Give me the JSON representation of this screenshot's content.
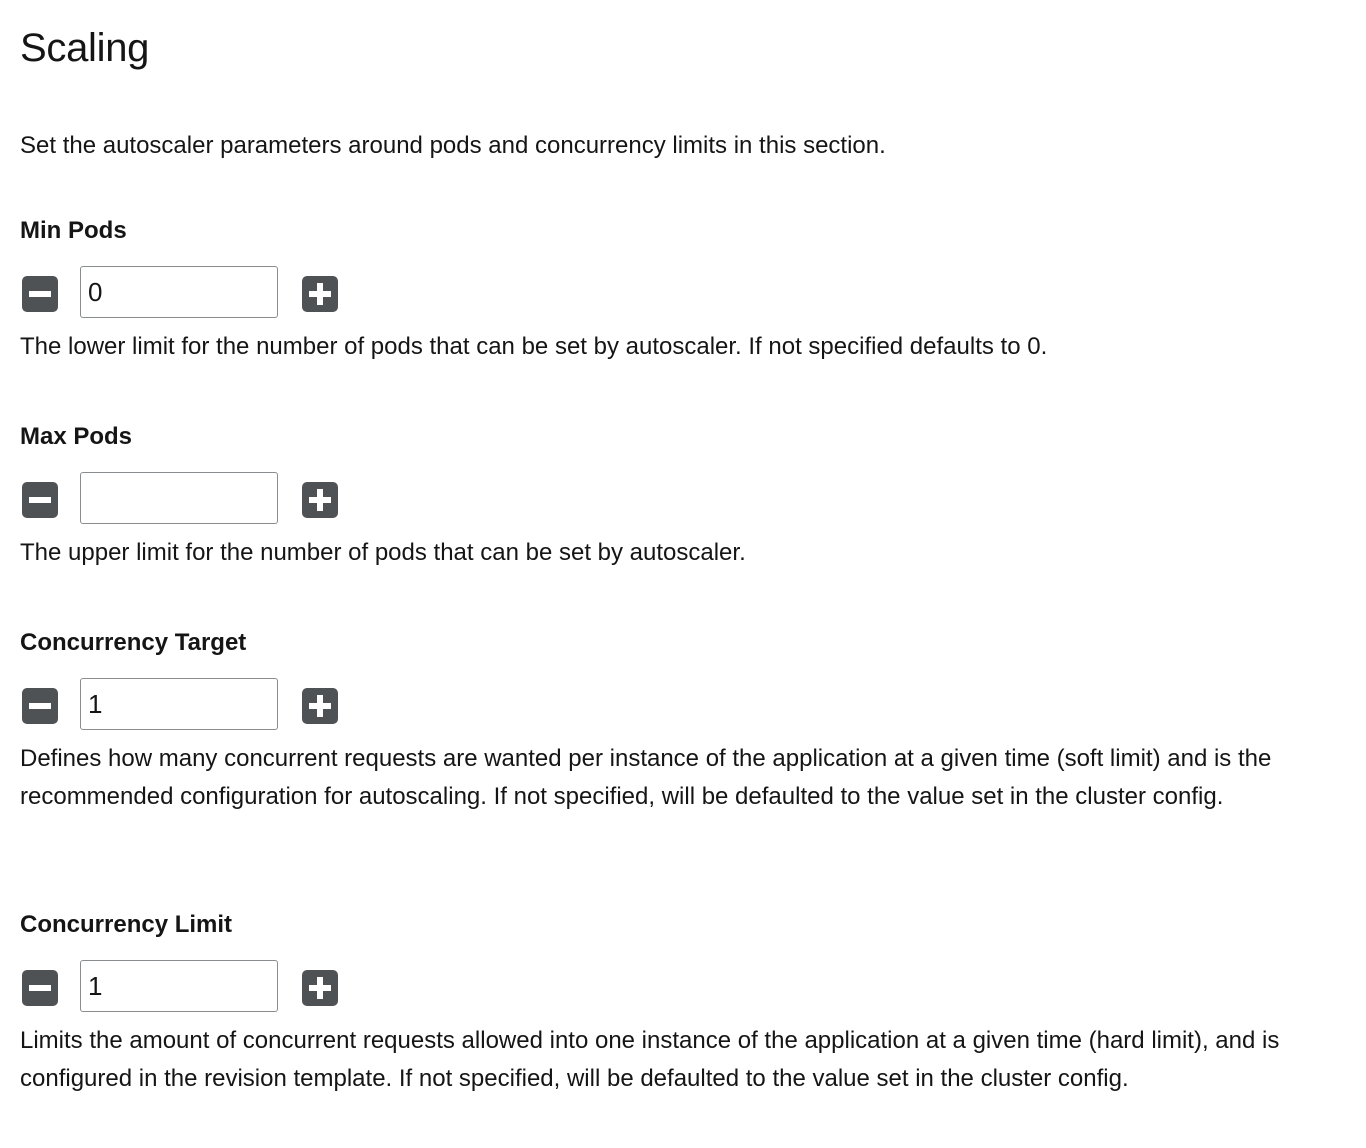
{
  "section": {
    "title": "Scaling",
    "description": "Set the autoscaler parameters around pods and concurrency limits in this section."
  },
  "fields": [
    {
      "label": "Min Pods",
      "value": "0",
      "helper": "The lower limit for the number of pods that can be set by autoscaler. If not specified defaults to 0."
    },
    {
      "label": "Max Pods",
      "value": "",
      "helper": "The upper limit for the number of pods that can be set by autoscaler."
    },
    {
      "label": "Concurrency Target",
      "value": "1",
      "helper": "Defines how many concurrent requests are wanted per instance of the application at a given time (soft limit) and is the recommended configuration for autoscaling. If not specified, will be defaulted to the value set in the cluster config."
    },
    {
      "label": "Concurrency Limit",
      "value": "1",
      "helper": "Limits the amount of concurrent requests allowed into one instance of the application at a given time (hard limit), and is configured in the revision template. If not specified, will be defaulted to the value set in the cluster config."
    }
  ],
  "icons": {
    "decrement": "minus-square-icon",
    "increment": "plus-square-icon"
  },
  "colors": {
    "text": "#151515",
    "button": "#4f5255",
    "input_border": "#8a8d90"
  }
}
